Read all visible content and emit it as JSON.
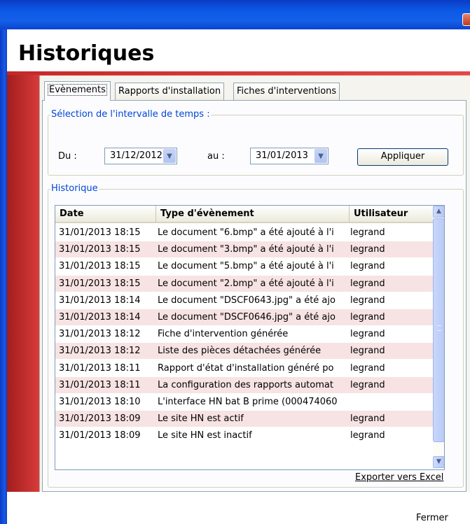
{
  "window": {
    "title": "Historiques"
  },
  "tabs": [
    {
      "label": "Evènements",
      "selected": true
    },
    {
      "label": "Rapports d'installation",
      "selected": false
    },
    {
      "label": "Fiches d'interventions",
      "selected": false
    }
  ],
  "time_range": {
    "legend": "Sélection de l'intervalle de temps :",
    "from_label": "Du :",
    "from_value": "31/12/2012",
    "to_label": "au :",
    "to_value": "31/01/2013",
    "apply_label": "Appliquer"
  },
  "history": {
    "legend": "Historique",
    "columns": [
      "Date",
      "Type d'évènement",
      "Utilisateur"
    ],
    "rows": [
      {
        "date": "31/01/2013 18:15",
        "type": "Le document \"6.bmp\" a été ajouté à l'i",
        "user": "legrand"
      },
      {
        "date": "31/01/2013 18:15",
        "type": "Le document \"3.bmp\" a été ajouté à l'i",
        "user": "legrand"
      },
      {
        "date": "31/01/2013 18:15",
        "type": "Le document \"5.bmp\" a été ajouté à l'i",
        "user": "legrand"
      },
      {
        "date": "31/01/2013 18:15",
        "type": "Le document \"2.bmp\" a été ajouté à l'i",
        "user": "legrand"
      },
      {
        "date": "31/01/2013 18:14",
        "type": "Le document \"DSCF0643.jpg\" a été ajo",
        "user": "legrand"
      },
      {
        "date": "31/01/2013 18:14",
        "type": "Le document \"DSCF0646.jpg\" a été ajo",
        "user": "legrand"
      },
      {
        "date": "31/01/2013 18:12",
        "type": "Fiche d'intervention générée",
        "user": "legrand"
      },
      {
        "date": "31/01/2013 18:12",
        "type": "Liste des pièces détachées générée",
        "user": "legrand"
      },
      {
        "date": "31/01/2013 18:11",
        "type": "Rapport d'état d'installation généré po",
        "user": "legrand"
      },
      {
        "date": "31/01/2013 18:11",
        "type": "La configuration des rapports automat",
        "user": "legrand"
      },
      {
        "date": "31/01/2013 18:10",
        "type": "L'interface HN bat B prime (000474060",
        "user": ""
      },
      {
        "date": "31/01/2013 18:09",
        "type": "Le site HN est actif",
        "user": "legrand"
      },
      {
        "date": "31/01/2013 18:09",
        "type": "Le site HN est inactif",
        "user": "legrand"
      }
    ]
  },
  "export_label": "Exporter vers Excel",
  "close_label": "Fermer",
  "colors": {
    "titlebar": "#0c58e6",
    "header_red": "#d83b3b",
    "legend_blue": "#0046d5",
    "row_alt": "#f7e3e3"
  },
  "icons": {
    "combo": "chevron-down-icon",
    "scroll_up": "arrow-up-icon",
    "scroll_down": "arrow-down-icon"
  }
}
